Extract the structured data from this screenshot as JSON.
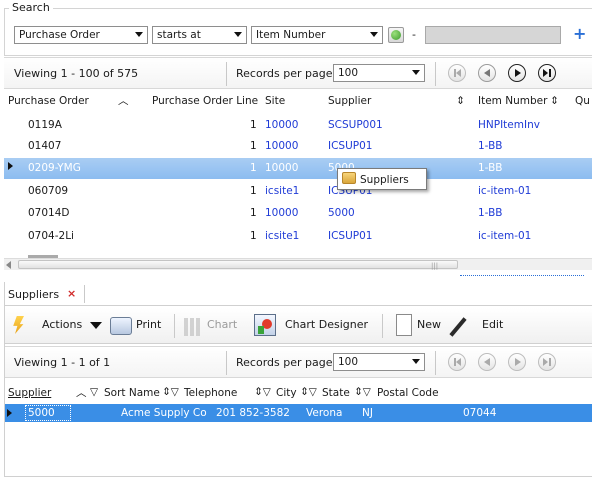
{
  "search": {
    "legend": "Search",
    "field": "Purchase Order",
    "operator": "starts at",
    "column": "Item Number",
    "separator": "-",
    "value": ""
  },
  "top_pager": {
    "viewing": "Viewing 1 - 100  of  575",
    "records_label": "Records per page:",
    "records_value": "100"
  },
  "grid": {
    "columns": [
      "Purchase Order",
      "Purchase Order Line",
      "Site",
      "Supplier",
      "Item Number",
      "Qu"
    ],
    "rows": [
      {
        "po": "0119A",
        "line": "1",
        "site": "10000",
        "supplier": "SCSUP001",
        "item": "HNPItemInv",
        "selected": false
      },
      {
        "po": "01407",
        "line": "1",
        "site": "10000",
        "supplier": "ICSUP01",
        "item": "1-BB",
        "selected": false
      },
      {
        "po": "0209-YMG",
        "line": "1",
        "site": "10000",
        "supplier": "5000",
        "item": "1-BB",
        "selected": true
      },
      {
        "po": "060709",
        "line": "1",
        "site": "icsite1",
        "supplier": "ICSUP01",
        "item": "ic-item-01",
        "selected": false
      },
      {
        "po": "07014D",
        "line": "1",
        "site": "10000",
        "supplier": "5000",
        "item": "1-BB",
        "selected": false
      },
      {
        "po": "0704-2Li",
        "line": "1",
        "site": "icsite1",
        "supplier": "ICSUP01",
        "item": "ic-item-01",
        "selected": false
      }
    ]
  },
  "context_menu": {
    "item": "Suppliers"
  },
  "subtab": {
    "label": "Suppliers",
    "close": "×"
  },
  "toolbar": {
    "actions": "Actions",
    "print": "Print",
    "chart": "Chart",
    "chart_designer": "Chart Designer",
    "new": "New",
    "edit": "Edit"
  },
  "bottom_pager": {
    "viewing": "Viewing 1 - 1  of  1",
    "records_label": "Records per page:",
    "records_value": "100"
  },
  "supplier_grid": {
    "columns": [
      "Supplier",
      "Sort Name",
      "Telephone",
      "City",
      "State",
      "Postal Code"
    ],
    "rows": [
      {
        "supplier": "5000",
        "sort_name": "Acme Supply Co",
        "telephone": "201 852-3582",
        "city": "Verona",
        "state": "NJ",
        "postal": "07044"
      }
    ]
  },
  "colors": {
    "selection": "#3a8ee6",
    "link": "#1f3bd6"
  }
}
